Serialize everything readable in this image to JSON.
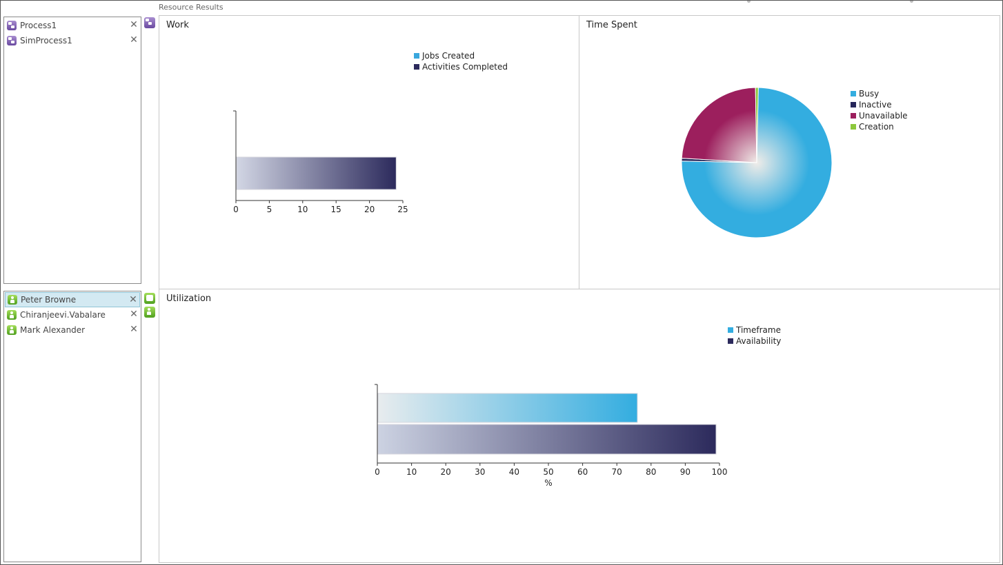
{
  "app": {
    "title": "Resource Results"
  },
  "processes": {
    "items": [
      {
        "label": "Process1",
        "close": "✕"
      },
      {
        "label": "SimProcess1",
        "close": "✕"
      }
    ]
  },
  "resources": {
    "items": [
      {
        "label": "Peter Browne",
        "close": "✕",
        "selected": true
      },
      {
        "label": "Chiranjeevi.Vabalare",
        "close": "✕"
      },
      {
        "label": "Mark Alexander",
        "close": "✕"
      }
    ]
  },
  "icons": {
    "process": "process-icon",
    "resource": "resource-icon",
    "resource_group": "resource-group-icon"
  },
  "charts": {
    "work": {
      "title": "Work"
    },
    "time_spent": {
      "title": "Time Spent"
    },
    "utilization": {
      "title": "Utilization"
    }
  },
  "chart_data": [
    {
      "id": "work",
      "type": "bar",
      "orientation": "horizontal",
      "title": "Work",
      "xlim": [
        0,
        25
      ],
      "x_ticks": [
        "0",
        "5",
        "10",
        "15",
        "20",
        "25"
      ],
      "legend": "top-right",
      "series": [
        {
          "name": "Jobs Created",
          "color": "#3aa7dd",
          "values": [
            0
          ]
        },
        {
          "name": "Activities Completed",
          "color": "#2c2a5c",
          "values": [
            24
          ]
        }
      ]
    },
    {
      "id": "time_spent",
      "type": "pie",
      "title": "Time Spent",
      "legend": "right",
      "slices": [
        {
          "name": "Busy",
          "color": "#33ade0",
          "value": 75
        },
        {
          "name": "Inactive",
          "color": "#27275a",
          "value": 0.6
        },
        {
          "name": "Unavailable",
          "color": "#9c1f5d",
          "value": 23.8
        },
        {
          "name": "Creation",
          "color": "#8cc83c",
          "value": 0.6
        }
      ]
    },
    {
      "id": "utilization",
      "type": "bar",
      "orientation": "horizontal",
      "title": "Utilization",
      "xlabel": "%",
      "xlim": [
        0,
        100
      ],
      "x_ticks": [
        "0",
        "10",
        "20",
        "30",
        "40",
        "50",
        "60",
        "70",
        "80",
        "90",
        "100"
      ],
      "legend": "top-right",
      "series": [
        {
          "name": "Timeframe",
          "color": "#33ade0",
          "values": [
            76
          ]
        },
        {
          "name": "Availability",
          "color": "#2c2a5c",
          "values": [
            99
          ]
        }
      ]
    }
  ]
}
